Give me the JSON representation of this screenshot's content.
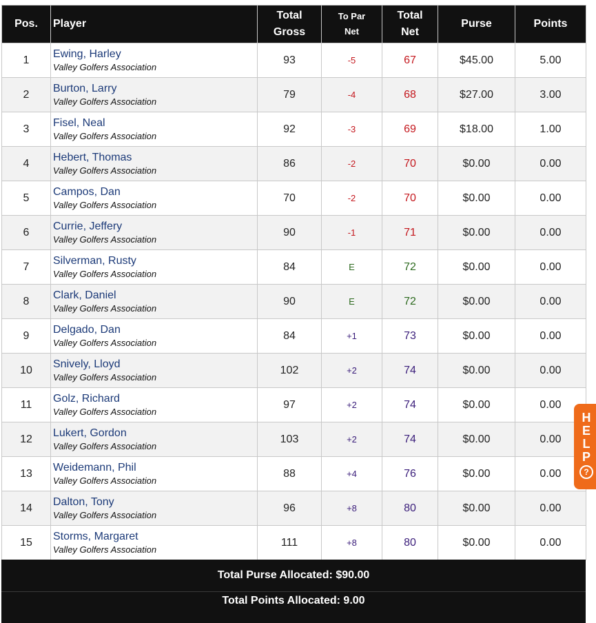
{
  "headers": {
    "pos": "Pos.",
    "player": "Player",
    "gross_l1": "Total",
    "gross_l2": "Gross",
    "topar_l1": "To Par",
    "topar_l2": "Net",
    "net_l1": "Total",
    "net_l2": "Net",
    "purse": "Purse",
    "points": "Points"
  },
  "rows": [
    {
      "pos": "1",
      "name": "Ewing, Harley",
      "club": "Valley Golfers Association",
      "gross": "93",
      "topar": "-5",
      "net": "67",
      "purse": "$45.00",
      "points": "5.00",
      "tone": "red"
    },
    {
      "pos": "2",
      "name": "Burton, Larry",
      "club": "Valley Golfers Association",
      "gross": "79",
      "topar": "-4",
      "net": "68",
      "purse": "$27.00",
      "points": "3.00",
      "tone": "red"
    },
    {
      "pos": "3",
      "name": "Fisel, Neal",
      "club": "Valley Golfers Association",
      "gross": "92",
      "topar": "-3",
      "net": "69",
      "purse": "$18.00",
      "points": "1.00",
      "tone": "red"
    },
    {
      "pos": "4",
      "name": "Hebert, Thomas",
      "club": "Valley Golfers Association",
      "gross": "86",
      "topar": "-2",
      "net": "70",
      "purse": "$0.00",
      "points": "0.00",
      "tone": "red"
    },
    {
      "pos": "5",
      "name": "Campos, Dan",
      "club": "Valley Golfers Association",
      "gross": "70",
      "topar": "-2",
      "net": "70",
      "purse": "$0.00",
      "points": "0.00",
      "tone": "red"
    },
    {
      "pos": "6",
      "name": "Currie, Jeffery",
      "club": "Valley Golfers Association",
      "gross": "90",
      "topar": "-1",
      "net": "71",
      "purse": "$0.00",
      "points": "0.00",
      "tone": "red"
    },
    {
      "pos": "7",
      "name": "Silverman, Rusty",
      "club": "Valley Golfers Association",
      "gross": "84",
      "topar": "E",
      "net": "72",
      "purse": "$0.00",
      "points": "0.00",
      "tone": "green"
    },
    {
      "pos": "8",
      "name": "Clark, Daniel",
      "club": "Valley Golfers Association",
      "gross": "90",
      "topar": "E",
      "net": "72",
      "purse": "$0.00",
      "points": "0.00",
      "tone": "green"
    },
    {
      "pos": "9",
      "name": "Delgado, Dan",
      "club": "Valley Golfers Association",
      "gross": "84",
      "topar": "+1",
      "net": "73",
      "purse": "$0.00",
      "points": "0.00",
      "tone": "purple"
    },
    {
      "pos": "10",
      "name": "Snively, Lloyd",
      "club": "Valley Golfers Association",
      "gross": "102",
      "topar": "+2",
      "net": "74",
      "purse": "$0.00",
      "points": "0.00",
      "tone": "purple"
    },
    {
      "pos": "11",
      "name": "Golz, Richard",
      "club": "Valley Golfers Association",
      "gross": "97",
      "topar": "+2",
      "net": "74",
      "purse": "$0.00",
      "points": "0.00",
      "tone": "purple"
    },
    {
      "pos": "12",
      "name": "Lukert, Gordon",
      "club": "Valley Golfers Association",
      "gross": "103",
      "topar": "+2",
      "net": "74",
      "purse": "$0.00",
      "points": "0.00",
      "tone": "purple"
    },
    {
      "pos": "13",
      "name": "Weidemann, Phil",
      "club": "Valley Golfers Association",
      "gross": "88",
      "topar": "+4",
      "net": "76",
      "purse": "$0.00",
      "points": "0.00",
      "tone": "purple"
    },
    {
      "pos": "14",
      "name": "Dalton, Tony",
      "club": "Valley Golfers Association",
      "gross": "96",
      "topar": "+8",
      "net": "80",
      "purse": "$0.00",
      "points": "0.00",
      "tone": "purple"
    },
    {
      "pos": "15",
      "name": "Storms, Margaret",
      "club": "Valley Golfers Association",
      "gross": "111",
      "topar": "+8",
      "net": "80",
      "purse": "$0.00",
      "points": "0.00",
      "tone": "purple"
    }
  ],
  "footer": {
    "purse_total": "Total Purse Allocated: $90.00",
    "points_total": "Total Points Allocated: 9.00"
  },
  "help": {
    "letters": [
      "H",
      "E",
      "L",
      "P"
    ],
    "icon": "question-circle-icon",
    "icon_glyph": "?"
  },
  "colors": {
    "under_par": "#c4161c",
    "even_par": "#2d6a1f",
    "over_par": "#3a1d7a",
    "player_link": "#1c3a78",
    "header_bg": "#111111",
    "help_bg": "#ef6b1a"
  }
}
